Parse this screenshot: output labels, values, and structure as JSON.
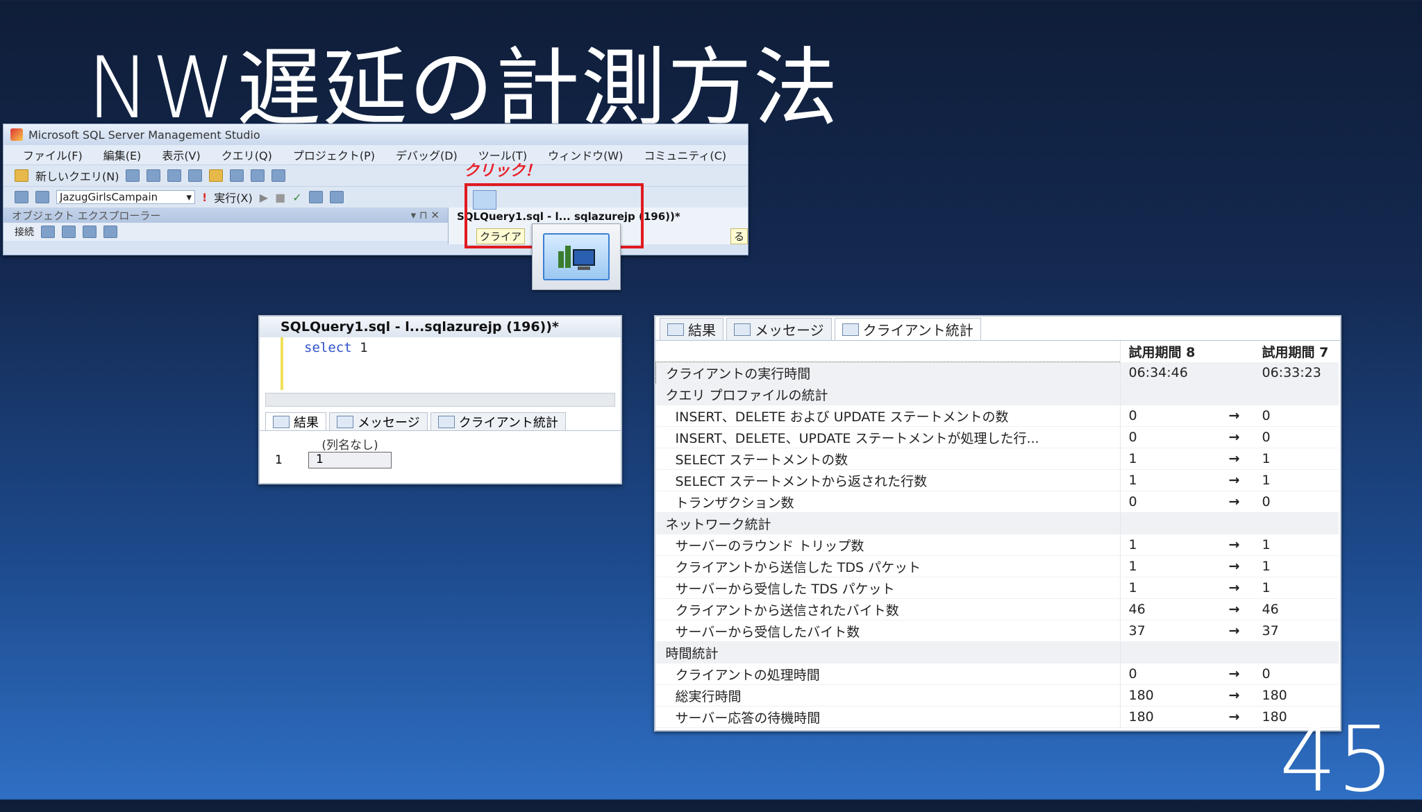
{
  "slide": {
    "title": "NW遅延の計測方法",
    "number": "45"
  },
  "ssms": {
    "window_title": "Microsoft SQL Server Management Studio",
    "menu": [
      "ファイル(F)",
      "編集(E)",
      "表示(V)",
      "クエリ(Q)",
      "プロジェクト(P)",
      "デバッグ(D)",
      "ツール(T)",
      "ウィンドウ(W)",
      "コミュニティ(C)"
    ],
    "new_query_label": "新しいクエリ(N)",
    "database": "JazugGirlsCampain",
    "execute_label": "実行(X)",
    "object_explorer_title": "オブジェクト エクスプローラー",
    "connect_label": "接続",
    "doc_tab": "SQLQuery1.sql - l... sqlazurejp (196))*",
    "doc_tab_fragment_left": "クライア",
    "doc_tab_fragment_right": "る",
    "click_annotation": "クリック！"
  },
  "query_window": {
    "title": "SQLQuery1.sql - l...sqlazurejp (196))*",
    "code_keyword": "select",
    "code_value": "1",
    "tabs": [
      "結果",
      "メッセージ",
      "クライアント統計"
    ],
    "grid_header": "(列名なし)",
    "row_number": "1",
    "cell_value": "1"
  },
  "stats": {
    "tabs": [
      "結果",
      "メッセージ",
      "クライアント統計"
    ],
    "col1": "試用期間  8",
    "col2": "試用期間  7",
    "rows": [
      {
        "label": "クライアントの実行時間",
        "v1": "06:34:46",
        "arrow": "",
        "v2": "06:33:23"
      },
      {
        "label": "クエリ プロファイルの統計",
        "v1": "",
        "arrow": "",
        "v2": ""
      },
      {
        "label": "INSERT、DELETE および UPDATE ステートメントの数",
        "v1": "0",
        "arrow": "→",
        "v2": "0"
      },
      {
        "label": "INSERT、DELETE、UPDATE ステートメントが処理した行...",
        "v1": "0",
        "arrow": "→",
        "v2": "0"
      },
      {
        "label": "SELECT ステートメントの数",
        "v1": "1",
        "arrow": "→",
        "v2": "1"
      },
      {
        "label": "SELECT ステートメントから返された行数",
        "v1": "1",
        "arrow": "→",
        "v2": "1"
      },
      {
        "label": "トランザクション数",
        "v1": "0",
        "arrow": "→",
        "v2": "0"
      },
      {
        "label": "ネットワーク統計",
        "v1": "",
        "arrow": "",
        "v2": ""
      },
      {
        "label": "サーバーのラウンド トリップ数",
        "v1": "1",
        "arrow": "→",
        "v2": "1"
      },
      {
        "label": "クライアントから送信した TDS パケット",
        "v1": "1",
        "arrow": "→",
        "v2": "1"
      },
      {
        "label": "サーバーから受信した TDS パケット",
        "v1": "1",
        "arrow": "→",
        "v2": "1"
      },
      {
        "label": "クライアントから送信されたバイト数",
        "v1": "46",
        "arrow": "→",
        "v2": "46"
      },
      {
        "label": "サーバーから受信したバイト数",
        "v1": "37",
        "arrow": "→",
        "v2": "37"
      },
      {
        "label": "時間統計",
        "v1": "",
        "arrow": "",
        "v2": ""
      },
      {
        "label": "クライアントの処理時間",
        "v1": "0",
        "arrow": "→",
        "v2": "0"
      },
      {
        "label": "総実行時間",
        "v1": "180",
        "arrow": "→",
        "v2": "180"
      },
      {
        "label": "サーバー応答の待機時間",
        "v1": "180",
        "arrow": "→",
        "v2": "180"
      }
    ]
  }
}
